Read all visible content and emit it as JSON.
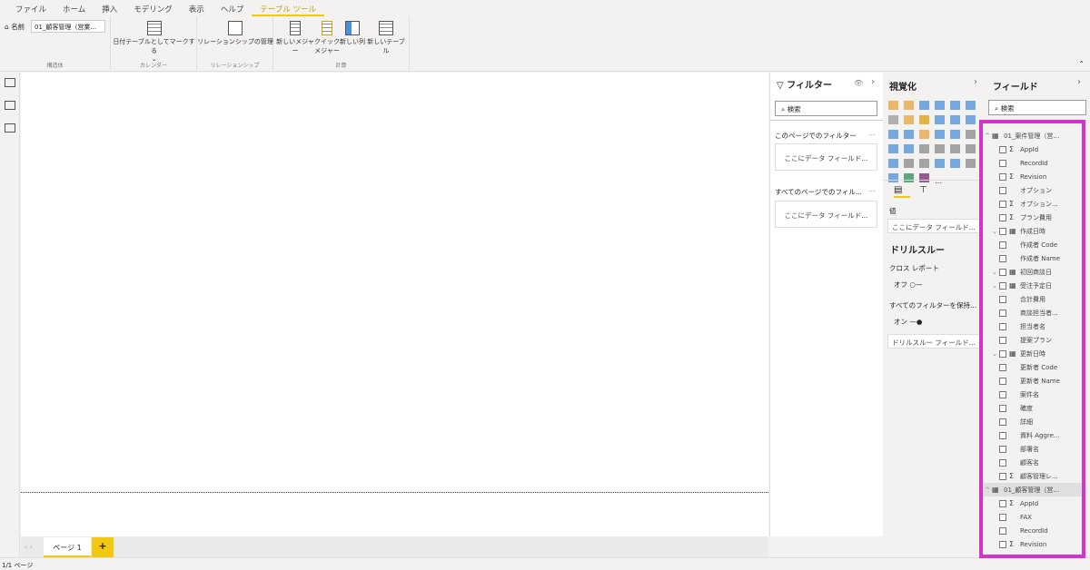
{
  "tabs": [
    "ファイル",
    "ホーム",
    "挿入",
    "モデリング",
    "表示",
    "ヘルプ",
    "テーブル ツール"
  ],
  "ribbon": {
    "name_label": "名前",
    "name_value": "01_顧客管理（営業...",
    "mark_date": "日付テーブルとしてマークする",
    "manage_rel": "リレーションシップの管理",
    "new_measure": "新しいメジャー",
    "quick_measure": "クイック メジャー",
    "new_column": "新しい列",
    "new_table": "新しいテーブル",
    "groups": [
      "構造体",
      "カレンダー",
      "リレーションシップ",
      "計算"
    ]
  },
  "filter": {
    "title": "フィルター",
    "search": "検索",
    "page_filters": "このページでのフィルター",
    "all_filters": "すべてのページでのフィル...",
    "more": "...",
    "drop": "ここにデータ フィールド..."
  },
  "viz": {
    "title": "視覚化",
    "values_label": "値",
    "values_drop": "ここにデータ フィールド...",
    "drill_title": "ドリルスルー",
    "cross_report": "クロス レポート",
    "cross_state": "オフ",
    "keep_filters": "すべてのフィルターを保持...",
    "keep_state": "オン",
    "drill_drop": "ドリルスルー フィールド...",
    "more": "⋯",
    "accent": "#f2c811"
  },
  "fields": {
    "title": "フィールド",
    "search": "検索",
    "rows": [
      {
        "t": "h",
        "l": "01_案件管理（営..."
      },
      {
        "s": "Σ",
        "l": "AppId"
      },
      {
        "l": "RecordId"
      },
      {
        "s": "Σ",
        "l": "Revision"
      },
      {
        "l": "オプション"
      },
      {
        "s": "Σ",
        "l": "オプション..."
      },
      {
        "s": "Σ",
        "l": "プラン費用"
      },
      {
        "d": 1,
        "l": "作成日時"
      },
      {
        "l": "作成者 Code"
      },
      {
        "l": "作成者 Name"
      },
      {
        "d": 1,
        "l": "初回商談日"
      },
      {
        "d": 1,
        "l": "受注予定日"
      },
      {
        "l": "合計費用"
      },
      {
        "l": "商談担当者..."
      },
      {
        "l": "担当者名"
      },
      {
        "l": "提案プラン"
      },
      {
        "d": 1,
        "l": "更新日時"
      },
      {
        "l": "更新者 Code"
      },
      {
        "l": "更新者 Name"
      },
      {
        "l": "案件名"
      },
      {
        "l": "確度"
      },
      {
        "l": "詳細"
      },
      {
        "l": "資料 Aggre..."
      },
      {
        "l": "部署名"
      },
      {
        "l": "顧客名"
      },
      {
        "s": "Σ",
        "l": "顧客管理レ..."
      },
      {
        "t": "h",
        "sel": 1,
        "l": "01_顧客管理（営..."
      },
      {
        "s": "Σ",
        "l": "AppId"
      },
      {
        "l": "FAX"
      },
      {
        "l": "RecordId"
      },
      {
        "s": "Σ",
        "l": "Revision"
      }
    ]
  },
  "pages": {
    "tab": "ページ 1",
    "add": "+"
  },
  "status": "1/1 ページ"
}
